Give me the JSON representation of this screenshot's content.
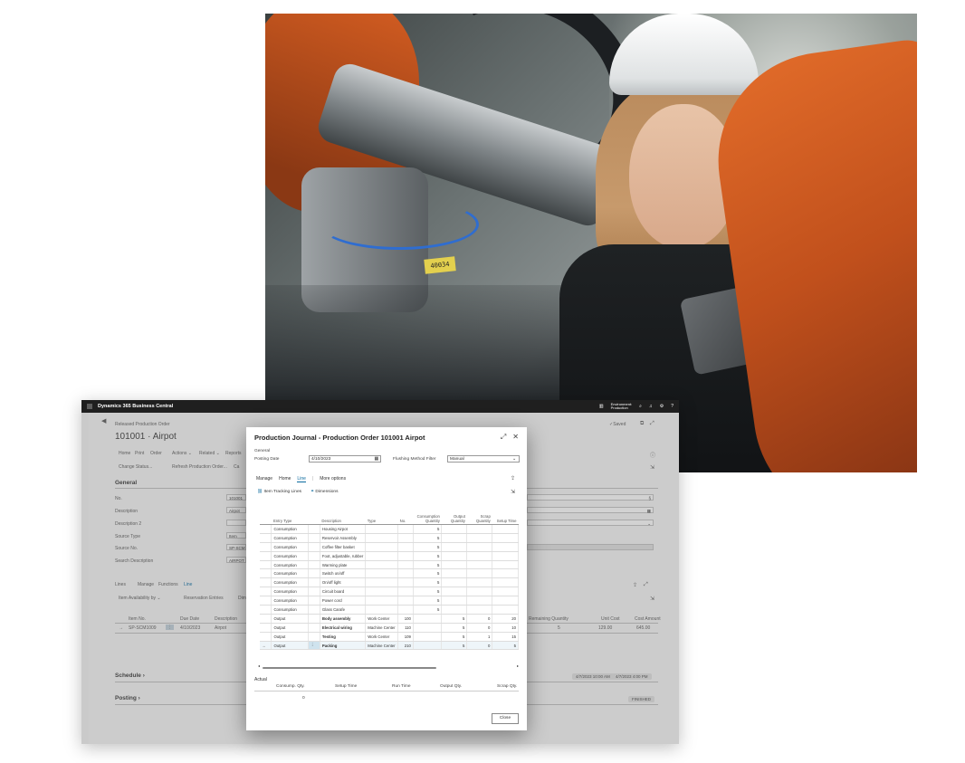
{
  "photo": {
    "label_tag": "40034"
  },
  "bc": {
    "app_title": "Dynamics 365 Business Central",
    "environment_line1": "Environment:",
    "environment_line2": "Production",
    "breadcrumb": "Released Production Order",
    "page_title": "101001 · Airpot",
    "saved": "✓Saved",
    "menu": [
      "Home",
      "Print",
      "Order",
      "Actions ⌄",
      "Related ⌄",
      "Reports"
    ],
    "actions": [
      "Change Status...",
      "Refresh Production Order...",
      "Ca"
    ],
    "general_header": "General",
    "fields": [
      {
        "label": "No.",
        "value": "101001"
      },
      {
        "label": "Description",
        "value": "Airpot"
      },
      {
        "label": "Description 2",
        "value": ""
      },
      {
        "label": "Source Type",
        "value": "Item"
      },
      {
        "label": "Source No.",
        "value": "SP-SCM"
      },
      {
        "label": "Search Description",
        "value": "AIRPOT"
      }
    ],
    "lines_menu": [
      "Lines",
      "Manage",
      "Functions",
      "Line"
    ],
    "lines_actions": [
      "Item Availability by ⌄",
      "Reservation Entries",
      "Dim"
    ],
    "lines_headers": [
      "Item No.",
      "Due Date",
      "Description"
    ],
    "lines_row": {
      "item": "SP-SCM1009",
      "due": "4/10/2023",
      "desc": "Airpot"
    },
    "right_headers": [
      "Remaining Quantity",
      "Unit Cost",
      "Cost Amount"
    ],
    "right_row": {
      "remaining": "5",
      "unit_cost": "129.00",
      "cost_amount": "645.00"
    },
    "schedule": "Schedule ›",
    "posting": "Posting ›",
    "schedule_dates": [
      "4/7/2023 10:00 AM",
      "4/7/2023 4:00 PM"
    ],
    "posting_badge": "FINISHED"
  },
  "dialog": {
    "title": "Production Journal - Production Order 101001 Airpot",
    "general": "General",
    "posting_date_label": "Posting Date",
    "posting_date_value": "4/10/2023",
    "flushing_label": "Flushing Method Filter",
    "flushing_value": "Manual",
    "menu": [
      "Manage",
      "Home",
      "Line",
      "More options"
    ],
    "actions": [
      "Item Tracking Lines",
      "Dimensions"
    ],
    "columns": [
      "Entry Type",
      "Description",
      "Type",
      "No.",
      "Consumption Quantity",
      "Output Quantity",
      "Scrap Quantity",
      "Setup Time"
    ],
    "rows": [
      {
        "entry": "Consumption",
        "desc": "Housing Airpot",
        "type": "",
        "no": "",
        "cons": "5",
        "out": "",
        "scrap": "",
        "setup": ""
      },
      {
        "entry": "Consumption",
        "desc": "Reservoir Assembly",
        "type": "",
        "no": "",
        "cons": "5",
        "out": "",
        "scrap": "",
        "setup": ""
      },
      {
        "entry": "Consumption",
        "desc": "Coffee filter basket",
        "type": "",
        "no": "",
        "cons": "5",
        "out": "",
        "scrap": "",
        "setup": ""
      },
      {
        "entry": "Consumption",
        "desc": "Foot, adjustable, rubber",
        "type": "",
        "no": "",
        "cons": "5",
        "out": "",
        "scrap": "",
        "setup": ""
      },
      {
        "entry": "Consumption",
        "desc": "Warming plate",
        "type": "",
        "no": "",
        "cons": "5",
        "out": "",
        "scrap": "",
        "setup": ""
      },
      {
        "entry": "Consumption",
        "desc": "Switch on/off",
        "type": "",
        "no": "",
        "cons": "5",
        "out": "",
        "scrap": "",
        "setup": ""
      },
      {
        "entry": "Consumption",
        "desc": "On/off light",
        "type": "",
        "no": "",
        "cons": "5",
        "out": "",
        "scrap": "",
        "setup": ""
      },
      {
        "entry": "Consumption",
        "desc": "Circuit board",
        "type": "",
        "no": "",
        "cons": "5",
        "out": "",
        "scrap": "",
        "setup": ""
      },
      {
        "entry": "Consumption",
        "desc": "Power cord",
        "type": "",
        "no": "",
        "cons": "5",
        "out": "",
        "scrap": "",
        "setup": ""
      },
      {
        "entry": "Consumption",
        "desc": "Glass Carafe",
        "type": "",
        "no": "",
        "cons": "5",
        "out": "",
        "scrap": "",
        "setup": ""
      },
      {
        "entry": "Output",
        "desc": "Body assembly",
        "type": "Work Center",
        "no": "100",
        "cons": "",
        "out": "5",
        "scrap": "0",
        "setup": "20"
      },
      {
        "entry": "Output",
        "desc": "Electrical wiring",
        "type": "Machine Center",
        "no": "110",
        "cons": "",
        "out": "5",
        "scrap": "0",
        "setup": "10"
      },
      {
        "entry": "Output",
        "desc": "Testing",
        "type": "Work Center",
        "no": "109",
        "cons": "",
        "out": "5",
        "scrap": "1",
        "setup": "15"
      },
      {
        "entry": "Output",
        "desc": "Packing",
        "type": "Machine Center",
        "no": "210",
        "cons": "",
        "out": "5",
        "scrap": "0",
        "setup": "5"
      }
    ],
    "actual_label": "Actual",
    "actual_headers": [
      "Consump. Qty.",
      "Setup Time",
      "Run Time",
      "Output Qty.",
      "Scrap Qty."
    ],
    "actual_value": "0",
    "close_label": "Close"
  }
}
